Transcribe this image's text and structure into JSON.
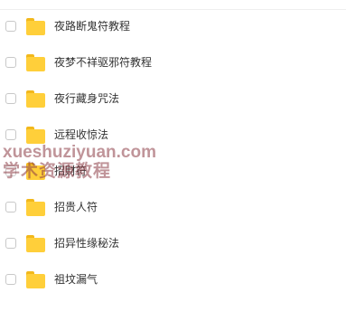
{
  "files": [
    {
      "name": "夜路断鬼符教程",
      "icon": "folder-icon"
    },
    {
      "name": "夜梦不祥驱邪符教程",
      "icon": "folder-icon"
    },
    {
      "name": "夜行藏身咒法",
      "icon": "folder-icon"
    },
    {
      "name": "远程收惊法",
      "icon": "folder-icon"
    },
    {
      "name": "招财符",
      "icon": "folder-icon"
    },
    {
      "name": "招贵人符",
      "icon": "folder-icon"
    },
    {
      "name": "招异性缘秘法",
      "icon": "folder-icon"
    },
    {
      "name": "祖坟漏气",
      "icon": "folder-icon"
    }
  ],
  "watermark": {
    "line1": "xueshuziyuan.com",
    "line2": "学术资源教程"
  },
  "colors": {
    "folder_body": "#ffcf3a",
    "folder_tab": "#f2b81c",
    "text": "#333333",
    "watermark": "#8c3c46"
  }
}
